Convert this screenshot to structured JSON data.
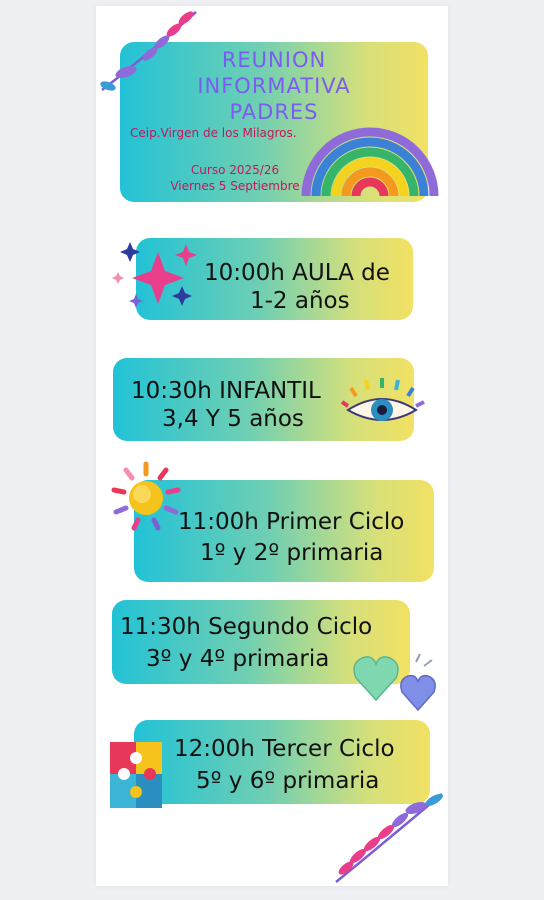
{
  "header": {
    "title_lines": [
      "REUNION",
      "INFORMATIVA",
      "PADRES"
    ],
    "school": "Ceip.Virgen de los Milagros.",
    "course": "Curso 2025/26",
    "date": "Viernes 5 Septiembre"
  },
  "sessions": [
    {
      "line1": "10:00h AULA de",
      "line2": "1-2 años",
      "icon": "sparkle-stars-icon"
    },
    {
      "line1": "10:30h INFANTIL",
      "line2": "3,4 Y 5 años",
      "icon": "rainbow-eye-icon"
    },
    {
      "line1": "11:00h Primer Ciclo",
      "line2": "1º y 2º primaria",
      "icon": "sun-icon"
    },
    {
      "line1": "11:30h Segundo Ciclo",
      "line2": "3º y 4º primaria",
      "icon": "hearts-icon"
    },
    {
      "line1": "12:00h Tercer Ciclo",
      "line2": "5º y 6º primaria",
      "icon": "puzzle-icon"
    }
  ],
  "decorations": {
    "top_leaf": "leaf-branch-icon",
    "rainbow": "rainbow-icon",
    "bottom_leaf": "leaf-branch-icon"
  },
  "colors": {
    "title": "#7b5cf0",
    "subtitle": "#c2185b",
    "gradient_start": "#22c2d6",
    "gradient_end": "#f2e163"
  }
}
